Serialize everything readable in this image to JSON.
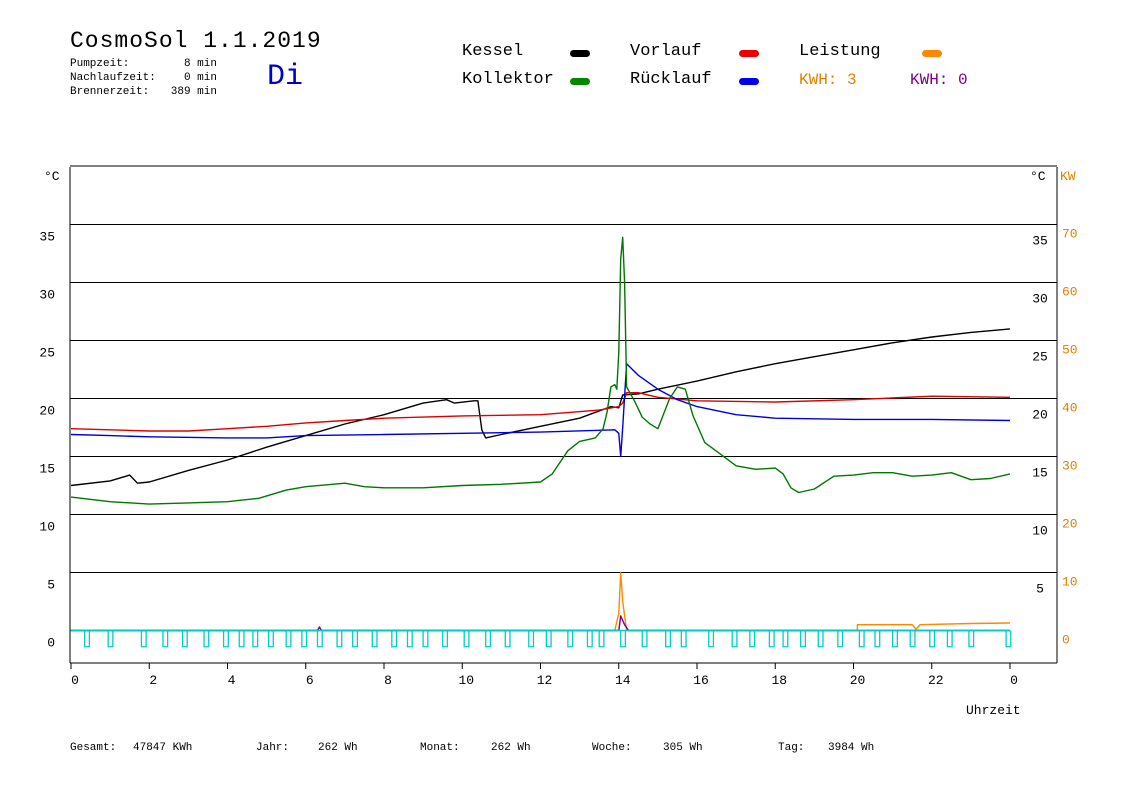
{
  "app": {
    "title": "CosmoSol 1.1.2019",
    "day": "Di"
  },
  "stats": [
    {
      "label": "Pumpzeit:",
      "value": "8 min"
    },
    {
      "label": "Nachlaufzeit:",
      "value": "0 min"
    },
    {
      "label": "Brennerzeit:",
      "value": "389 min"
    }
  ],
  "legend": [
    {
      "name": "Kessel",
      "color": "#000000"
    },
    {
      "name": "Vorlauf",
      "color": "#ee0000"
    },
    {
      "name": "Leistung",
      "color": "#ff8800"
    },
    {
      "name": "Kollektor",
      "color": "#008800"
    },
    {
      "name": "Rücklauf",
      "color": "#0000ee"
    }
  ],
  "kwh": [
    {
      "text": "KWH: 3",
      "color": "#e08000"
    },
    {
      "text": "KWH: 0",
      "color": "#800080"
    }
  ],
  "footer": [
    {
      "label": "Gesamt:",
      "value": "47847 KWh"
    },
    {
      "label": "Jahr:",
      "value": "262 Wh"
    },
    {
      "label": "Monat:",
      "value": "262 Wh"
    },
    {
      "label": "Woche:",
      "value": "305 Wh"
    },
    {
      "label": "Tag:",
      "value": "3984 Wh"
    }
  ],
  "chart_data": {
    "type": "line",
    "xlabel": "Uhrzeit",
    "x_ticks": [
      "0",
      "2",
      "4",
      "6",
      "8",
      "10",
      "12",
      "14",
      "16",
      "18",
      "20",
      "22",
      "0"
    ],
    "xlim": [
      0,
      24
    ],
    "ylabel_left": "°C",
    "ylabel_right": [
      "°C",
      "KW"
    ],
    "y_ticks_left": [
      "0",
      "5",
      "10",
      "15",
      "20",
      "25",
      "30",
      "35"
    ],
    "y_ticks_right_c": [
      "5",
      "10",
      "15",
      "20",
      "25",
      "30",
      "35"
    ],
    "y_ticks_right_kw": [
      "0",
      "10",
      "20",
      "30",
      "40",
      "50",
      "60",
      "70"
    ],
    "ylim": [
      -3,
      40
    ],
    "grid": "horizontal",
    "series": [
      {
        "name": "Kessel",
        "color": "#000000",
        "points": [
          [
            0,
            12.5
          ],
          [
            1,
            12.9
          ],
          [
            1.5,
            13.4
          ],
          [
            1.7,
            12.7
          ],
          [
            2,
            12.8
          ],
          [
            3,
            13.8
          ],
          [
            4,
            14.7
          ],
          [
            5,
            15.8
          ],
          [
            6,
            16.8
          ],
          [
            7,
            17.8
          ],
          [
            8,
            18.6
          ],
          [
            9,
            19.6
          ],
          [
            9.6,
            19.9
          ],
          [
            9.8,
            19.6
          ],
          [
            10.3,
            19.8
          ],
          [
            10.4,
            19.8
          ],
          [
            10.5,
            17.3
          ],
          [
            10.6,
            16.6
          ],
          [
            11,
            16.9
          ],
          [
            12,
            17.6
          ],
          [
            13,
            18.3
          ],
          [
            13.8,
            19.3
          ],
          [
            14,
            19.2
          ],
          [
            14.1,
            20.3
          ],
          [
            14.5,
            20.4
          ],
          [
            15,
            20.8
          ],
          [
            16,
            21.5
          ],
          [
            17,
            22.3
          ],
          [
            18,
            23.0
          ],
          [
            19,
            23.6
          ],
          [
            20,
            24.2
          ],
          [
            21,
            24.8
          ],
          [
            22,
            25.3
          ],
          [
            23,
            25.7
          ],
          [
            24,
            26.0
          ]
        ]
      },
      {
        "name": "Vorlauf",
        "color": "#dd0000",
        "points": [
          [
            0,
            17.4
          ],
          [
            1,
            17.3
          ],
          [
            2,
            17.2
          ],
          [
            3,
            17.2
          ],
          [
            4,
            17.4
          ],
          [
            5,
            17.6
          ],
          [
            6,
            17.9
          ],
          [
            7,
            18.1
          ],
          [
            8,
            18.3
          ],
          [
            10,
            18.5
          ],
          [
            12,
            18.6
          ],
          [
            13.5,
            19.0
          ],
          [
            14,
            19.3
          ],
          [
            14.1,
            19.6
          ],
          [
            14.2,
            20.5
          ],
          [
            14.5,
            20.5
          ],
          [
            15,
            20.1
          ],
          [
            16,
            19.8
          ],
          [
            18,
            19.7
          ],
          [
            20,
            19.9
          ],
          [
            22,
            20.2
          ],
          [
            24,
            20.1
          ]
        ]
      },
      {
        "name": "Rücklauf",
        "color": "#0000dd",
        "points": [
          [
            0,
            16.9
          ],
          [
            1,
            16.8
          ],
          [
            2,
            16.7
          ],
          [
            4,
            16.6
          ],
          [
            5,
            16.6
          ],
          [
            6,
            16.8
          ],
          [
            8,
            16.9
          ],
          [
            10,
            17.0
          ],
          [
            12,
            17.1
          ],
          [
            13.9,
            17.3
          ],
          [
            14,
            17.0
          ],
          [
            14.05,
            15.0
          ],
          [
            14.1,
            17.5
          ],
          [
            14.2,
            23.0
          ],
          [
            14.5,
            22.0
          ],
          [
            15,
            20.8
          ],
          [
            15.5,
            19.9
          ],
          [
            16,
            19.3
          ],
          [
            17,
            18.6
          ],
          [
            18,
            18.3
          ],
          [
            20,
            18.2
          ],
          [
            22,
            18.2
          ],
          [
            24,
            18.1
          ]
        ]
      },
      {
        "name": "Kollektor",
        "color": "#007700",
        "points": [
          [
            0,
            11.5
          ],
          [
            1,
            11.1
          ],
          [
            2,
            10.9
          ],
          [
            3,
            11.0
          ],
          [
            4,
            11.1
          ],
          [
            4.8,
            11.4
          ],
          [
            5.5,
            12.1
          ],
          [
            6,
            12.4
          ],
          [
            7,
            12.7
          ],
          [
            7.5,
            12.4
          ],
          [
            8,
            12.3
          ],
          [
            9,
            12.3
          ],
          [
            10,
            12.5
          ],
          [
            11,
            12.6
          ],
          [
            12,
            12.8
          ],
          [
            12.3,
            13.5
          ],
          [
            12.7,
            15.5
          ],
          [
            13,
            16.3
          ],
          [
            13.4,
            16.6
          ],
          [
            13.6,
            17.4
          ],
          [
            13.7,
            18.8
          ],
          [
            13.8,
            21.0
          ],
          [
            13.9,
            21.2
          ],
          [
            13.95,
            20.8
          ],
          [
            14.0,
            24.0
          ],
          [
            14.05,
            32.0
          ],
          [
            14.1,
            33.9
          ],
          [
            14.15,
            30.0
          ],
          [
            14.2,
            21.0
          ],
          [
            14.4,
            19.8
          ],
          [
            14.6,
            18.4
          ],
          [
            14.8,
            17.8
          ],
          [
            15.0,
            17.4
          ],
          [
            15.3,
            20.0
          ],
          [
            15.5,
            21.0
          ],
          [
            15.7,
            20.8
          ],
          [
            15.9,
            18.5
          ],
          [
            16.2,
            16.2
          ],
          [
            16.6,
            15.2
          ],
          [
            17,
            14.2
          ],
          [
            17.5,
            13.9
          ],
          [
            18,
            14.0
          ],
          [
            18.2,
            13.5
          ],
          [
            18.4,
            12.3
          ],
          [
            18.6,
            11.9
          ],
          [
            19,
            12.2
          ],
          [
            19.5,
            13.3
          ],
          [
            20,
            13.4
          ],
          [
            20.5,
            13.6
          ],
          [
            21,
            13.6
          ],
          [
            21.5,
            13.3
          ],
          [
            22,
            13.4
          ],
          [
            22.5,
            13.6
          ],
          [
            23,
            13.0
          ],
          [
            23.5,
            13.1
          ],
          [
            24,
            13.5
          ]
        ]
      },
      {
        "name": "Leistung",
        "color": "#ff8800",
        "axis": "kw",
        "points": [
          [
            0,
            0
          ],
          [
            13.9,
            0
          ],
          [
            14.0,
            3
          ],
          [
            14.05,
            10
          ],
          [
            14.1,
            5
          ],
          [
            14.2,
            0
          ],
          [
            20.1,
            0
          ],
          [
            20.1,
            1
          ],
          [
            21.5,
            1
          ],
          [
            21.6,
            0.2
          ],
          [
            21.7,
            1
          ],
          [
            23,
            1.2
          ],
          [
            24,
            1.3
          ]
        ]
      },
      {
        "name": "KWH",
        "color": "#800080",
        "axis": "kw",
        "points": [
          [
            0,
            0
          ],
          [
            6.3,
            0
          ],
          [
            6.35,
            0.6
          ],
          [
            6.4,
            0
          ],
          [
            14.0,
            0
          ],
          [
            14.05,
            2.5
          ],
          [
            14.15,
            1
          ],
          [
            14.25,
            0
          ],
          [
            24,
            0
          ]
        ]
      }
    ],
    "pump_pulses": {
      "color": "#00cccc",
      "starts": [
        0.35,
        0.95,
        1.8,
        2.35,
        2.85,
        3.4,
        3.9,
        4.3,
        4.65,
        5.05,
        5.5,
        5.9,
        6.3,
        6.8,
        7.2,
        7.7,
        8.2,
        8.6,
        9.0,
        9.5,
        10.05,
        10.6,
        11.1,
        11.7,
        12.15,
        12.7,
        13.2,
        13.5,
        14.05,
        14.6,
        15.2,
        15.6,
        16.3,
        16.9,
        17.35,
        17.85,
        18.2,
        18.65,
        19.1,
        19.6,
        20.15,
        20.55,
        21.0,
        21.45,
        21.95,
        22.4,
        22.95,
        23.9
      ],
      "width_h": 0.12,
      "depth": 1.4
    }
  }
}
